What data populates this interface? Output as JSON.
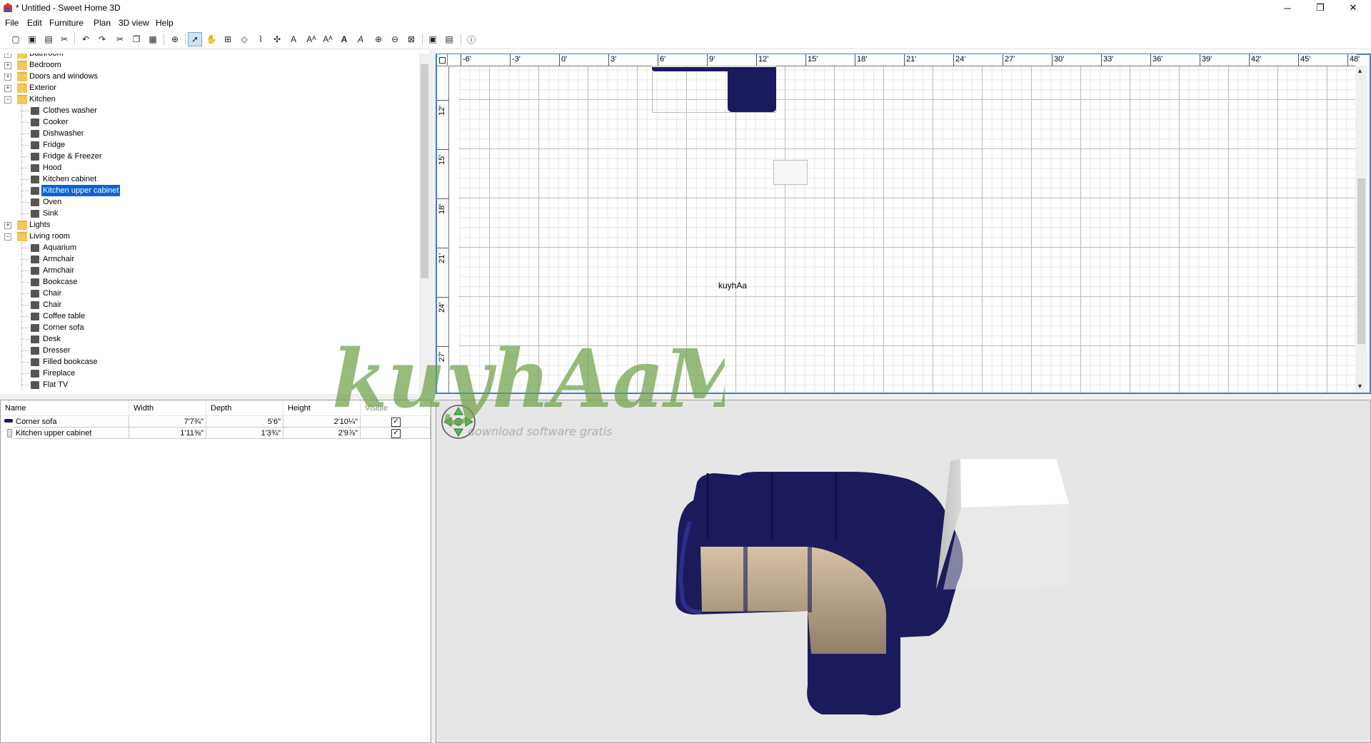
{
  "window": {
    "title": "* Untitled - Sweet Home 3D",
    "minimize": "─",
    "restore": "❐",
    "close": "✕"
  },
  "menu": [
    "File",
    "Edit",
    "Furniture",
    "Plan",
    "3D view",
    "Help"
  ],
  "toolbar_icons": [
    "new-home-icon",
    "new-from-demo-icon",
    "open-icon",
    "save-icon",
    "cut-icon",
    "undo-icon",
    "redo-icon",
    "copy-icon",
    "paste-icon",
    "add-furniture-icon",
    "select-mode-icon",
    "pan-mode-icon",
    "create-walls-icon",
    "create-rooms-icon",
    "create-polylines-icon",
    "create-dimensions-icon",
    "create-labels-icon",
    "increase-text-icon",
    "decrease-text-icon",
    "bold-icon",
    "italic-icon",
    "zoom-in-icon",
    "zoom-out-icon",
    "create-photo-icon",
    "create-video-icon",
    "preferences-icon",
    "help-icon"
  ],
  "catalog": {
    "categories": [
      {
        "label": "Bathroom",
        "expanded": false
      },
      {
        "label": "Bedroom",
        "expanded": false
      },
      {
        "label": "Doors and windows",
        "expanded": false
      },
      {
        "label": "Exterior",
        "expanded": false
      },
      {
        "label": "Kitchen",
        "expanded": true,
        "items": [
          "Clothes washer",
          "Cooker",
          "Dishwasher",
          "Fridge",
          "Fridge & Freezer",
          "Hood",
          "Kitchen cabinet",
          "Kitchen upper cabinet",
          "Oven",
          "Sink"
        ]
      },
      {
        "label": "Lights",
        "expanded": false
      },
      {
        "label": "Living room",
        "expanded": true,
        "items": [
          "Aquarium",
          "Armchair",
          "Armchair",
          "Bookcase",
          "Chair",
          "Chair",
          "Coffee table",
          "Corner sofa",
          "Desk",
          "Dresser",
          "Filled bookcase",
          "Fireplace",
          "Flat TV"
        ]
      }
    ],
    "selected": "Kitchen upper cabinet"
  },
  "furniture_table": {
    "headers": [
      "Name",
      "Width",
      "Depth",
      "Height",
      "Visible"
    ],
    "rows": [
      {
        "name": "Corner sofa",
        "width": "7'7¾\"",
        "depth": "5'6\"",
        "height": "2'10¼\"",
        "visible": true
      },
      {
        "name": "Kitchen upper cabinet",
        "width": "1'11⅝\"",
        "depth": "1'3¾\"",
        "height": "2'9⅞\"",
        "visible": true
      }
    ]
  },
  "plan": {
    "ruler_x": [
      "-6'",
      "-3'",
      "0'",
      "3'",
      "6'",
      "9'",
      "12'",
      "15'",
      "18'",
      "21'",
      "24'",
      "27'",
      "30'",
      "33'",
      "36'",
      "39'",
      "42'",
      "45'",
      "48'"
    ],
    "ruler_y": [
      "12'",
      "15'",
      "18'",
      "21'",
      "24'",
      "27'"
    ],
    "label": "kuyhAa"
  },
  "watermark": {
    "text": "kuyhAaMe",
    "subtext": "download software gratis"
  },
  "colors": {
    "selection": "#0a64d6",
    "sofa": "#1a1a5e",
    "plan_border": "#3e7bd6",
    "view_bg": "#e6e6e6"
  }
}
